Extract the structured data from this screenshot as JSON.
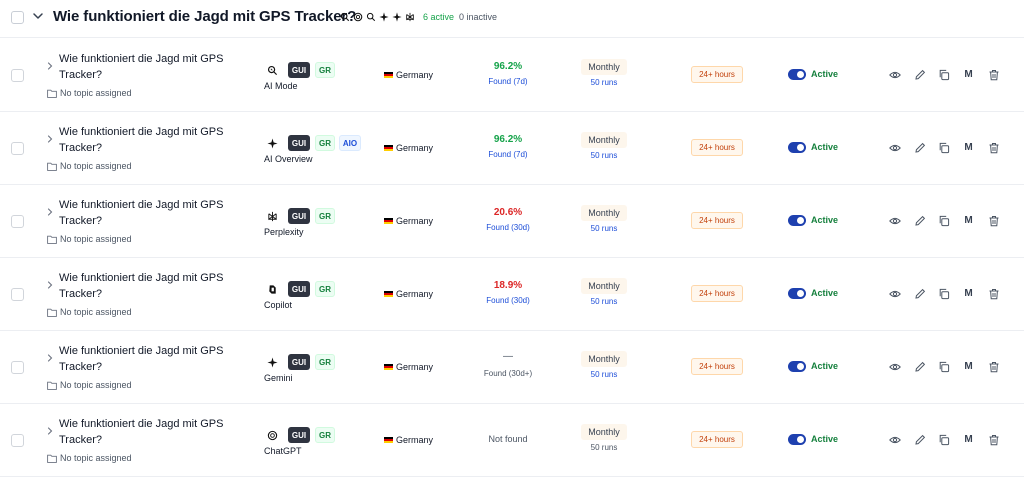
{
  "group": {
    "title": "Wie funktioniert die Jagd mit GPS Tracker?",
    "engine_icons": [
      "ai-mode-search-icon",
      "chatgpt-icon",
      "ai-mode-search-icon",
      "ai-overview-sparkle-icon",
      "gemini-sparkle-icon",
      "perplexity-icon"
    ],
    "active_count": "6 active",
    "inactive_count": "0 inactive"
  },
  "colors": {
    "accent_blue": "#1e40af",
    "positive_green": "#16a34a",
    "negative_red": "#dc2626",
    "link_blue": "#1d4ed8",
    "tag_dark": "#2f3440"
  },
  "rows": [
    {
      "prompt": "Wie funktioniert die Jagd mit GPS Tracker?",
      "topic": "No topic assigned",
      "engine": "AI Mode",
      "engine_icon": "ai-mode-search-icon",
      "tags": [
        "GUI",
        "GR"
      ],
      "country": "Germany",
      "visibility": "96.2%",
      "visibility_color": "#16a34a",
      "found": "Found (7d)",
      "frequency": "Monthly",
      "runs": "50 runs",
      "age": "24+ hours",
      "status": "Active",
      "mode_letter": "M"
    },
    {
      "prompt": "Wie funktioniert die Jagd mit GPS Tracker?",
      "topic": "No topic assigned",
      "engine": "AI Overview",
      "engine_icon": "ai-overview-sparkle-icon",
      "tags": [
        "GUI",
        "GR",
        "AIO"
      ],
      "country": "Germany",
      "visibility": "96.2%",
      "visibility_color": "#16a34a",
      "found": "Found (7d)",
      "frequency": "Monthly",
      "runs": "50 runs",
      "age": "24+ hours",
      "status": "Active",
      "mode_letter": "M"
    },
    {
      "prompt": "Wie funktioniert die Jagd mit GPS Tracker?",
      "topic": "No topic assigned",
      "engine": "Perplexity",
      "engine_icon": "perplexity-icon",
      "tags": [
        "GUI",
        "GR"
      ],
      "country": "Germany",
      "visibility": "20.6%",
      "visibility_color": "#dc2626",
      "found": "Found (30d)",
      "frequency": "Monthly",
      "runs": "50 runs",
      "age": "24+ hours",
      "status": "Active",
      "mode_letter": "M"
    },
    {
      "prompt": "Wie funktioniert die Jagd mit GPS Tracker?",
      "topic": "No topic assigned",
      "engine": "Copilot",
      "engine_icon": "copilot-icon",
      "tags": [
        "GUI",
        "GR"
      ],
      "country": "Germany",
      "visibility": "18.9%",
      "visibility_color": "#dc2626",
      "found": "Found (30d)",
      "frequency": "Monthly",
      "runs": "50 runs",
      "age": "24+ hours",
      "status": "Active",
      "mode_letter": "M"
    },
    {
      "prompt": "Wie funktioniert die Jagd mit GPS Tracker?",
      "topic": "No topic assigned",
      "engine": "Gemini",
      "engine_icon": "gemini-sparkle-icon",
      "tags": [
        "GUI",
        "GR"
      ],
      "country": "Germany",
      "visibility": "—",
      "visibility_color": "#4b5563",
      "found": "Found (30d+)",
      "frequency": "Monthly",
      "runs": "50 runs",
      "age": "24+ hours",
      "status": "Active",
      "mode_letter": "M"
    },
    {
      "prompt": "Wie funktioniert die Jagd mit GPS Tracker?",
      "topic": "No topic assigned",
      "engine": "ChatGPT",
      "engine_icon": "chatgpt-icon",
      "tags": [
        "GUI",
        "GR"
      ],
      "country": "Germany",
      "visibility": "Not found",
      "visibility_color": "#4b5563",
      "found": "",
      "frequency": "Monthly",
      "runs": "50 runs",
      "age": "24+ hours",
      "status": "Active",
      "mode_letter": "M"
    }
  ]
}
